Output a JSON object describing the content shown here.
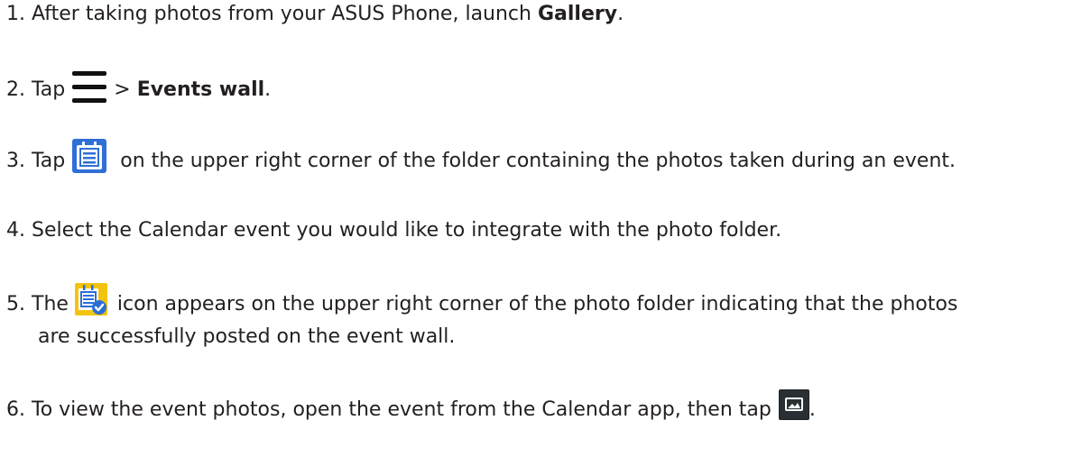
{
  "steps": [
    {
      "number": "1.",
      "text_before": "After taking photos from your ASUS Phone, launch ",
      "bold": "Gallery",
      "text_after": "."
    },
    {
      "number": "2.",
      "text_before": "Tap",
      "icon": "menu-icon",
      "separator": ">",
      "bold": "Events wall",
      "text_after": "."
    },
    {
      "number": "3.",
      "text_before": "Tap",
      "icon": "calendar-icon",
      "text_after": "on the upper right corner of the folder containing the photos taken during an event."
    },
    {
      "number": "4.",
      "text": "Select the Calendar event you would like to integrate with the photo folder."
    },
    {
      "number": "5.",
      "text_before": "The",
      "icon": "calendar-posted-icon",
      "text_after": "icon appears on the upper right corner of the photo folder indicating that the photos",
      "text_line2": "are successfully posted on the event wall."
    },
    {
      "number": "6.",
      "text_before": "To view the event photos, open the event from the Calendar app, then tap",
      "icon": "image-icon",
      "text_after": "."
    }
  ],
  "colors": {
    "text": "#231f20",
    "calendar_icon_blue": "#2f6fd6",
    "posted_icon_yellow": "#f2c40f",
    "posted_check_blue": "#2a6fd8",
    "image_icon_dark": "#1f2326"
  }
}
